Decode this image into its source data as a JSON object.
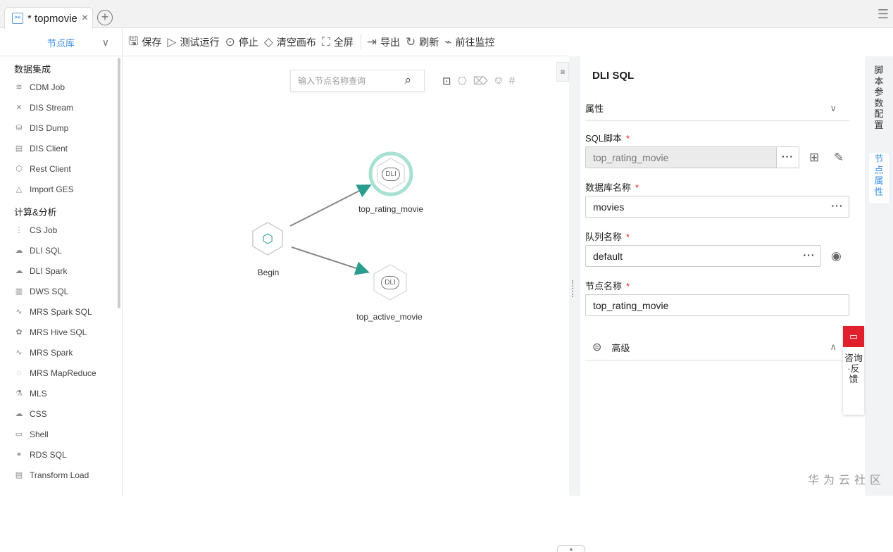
{
  "tab": {
    "title": "* topmovie",
    "close": "×",
    "add": "+"
  },
  "menu_icon": "☰",
  "library": {
    "title": "节点库",
    "chevron": "⌄"
  },
  "toolbar": [
    {
      "icon": "save-icon",
      "glyph": "🖫",
      "label": "保存"
    },
    {
      "icon": "play-icon",
      "glyph": "▷",
      "label": "测试运行"
    },
    {
      "icon": "stop-icon",
      "glyph": "⊙",
      "label": "停止"
    },
    {
      "icon": "eraser-icon",
      "glyph": "◇",
      "label": "清空画布"
    },
    {
      "icon": "fullscreen-icon",
      "glyph": "⛶",
      "label": "全屏"
    },
    {
      "icon": "export-icon",
      "glyph": "⇥",
      "label": "导出"
    },
    {
      "icon": "refresh-icon",
      "glyph": "↻",
      "label": "刷新"
    },
    {
      "icon": "monitor-icon",
      "glyph": "⌁",
      "label": "前往监控"
    }
  ],
  "sidebar": {
    "cat1": "数据集成",
    "items1": [
      {
        "label": "CDM Job",
        "g": "≋"
      },
      {
        "label": "DIS Stream",
        "g": "✕"
      },
      {
        "label": "DIS Dump",
        "g": "⛁"
      },
      {
        "label": "DIS Client",
        "g": "▤"
      },
      {
        "label": "Rest Client",
        "g": "⬡"
      },
      {
        "label": "Import GES",
        "g": "△"
      }
    ],
    "cat2": "计算&分析",
    "items2": [
      {
        "label": "CS Job",
        "g": "⋮"
      },
      {
        "label": "DLI SQL",
        "g": "☁"
      },
      {
        "label": "DLI Spark",
        "g": "☁"
      },
      {
        "label": "DWS SQL",
        "g": "▥"
      },
      {
        "label": "MRS Spark SQL",
        "g": "∿"
      },
      {
        "label": "MRS Hive SQL",
        "g": "✿"
      },
      {
        "label": "MRS Spark",
        "g": "∿"
      },
      {
        "label": "MRS MapReduce",
        "g": "◌"
      },
      {
        "label": "MLS",
        "g": "⚗"
      },
      {
        "label": "CSS",
        "g": "☁"
      },
      {
        "label": "Shell",
        "g": "▭"
      },
      {
        "label": "RDS SQL",
        "g": "⚭"
      },
      {
        "label": "Transform Load",
        "g": "▤"
      }
    ]
  },
  "canvas": {
    "search_placeholder": "输入节点名称查询",
    "nodes": {
      "begin": "Begin",
      "top_rating": "top_rating_movie",
      "top_active": "top_active_movie",
      "dli": "DLI"
    }
  },
  "panel": {
    "title": "DLI SQL",
    "section": "属性",
    "sql_label": "SQL脚本",
    "sql_value": "top_rating_movie",
    "db_label": "数据库名称",
    "db_value": "movies",
    "queue_label": "队列名称",
    "queue_value": "default",
    "node_label": "节点名称",
    "node_value": "top_rating_movie",
    "advanced": "高级",
    "required": "*",
    "dots": "···"
  },
  "right_tabs": {
    "script_params": "脚本参数配置",
    "node_props": "节点属性"
  },
  "feedback": "咨询·反馈",
  "watermark": "华为云社区",
  "colors": {
    "accent": "#3a8ee6",
    "node_selected": "#a8e0d4",
    "edge_arrow": "#2a9d8f",
    "feedback": "#e0202c"
  }
}
